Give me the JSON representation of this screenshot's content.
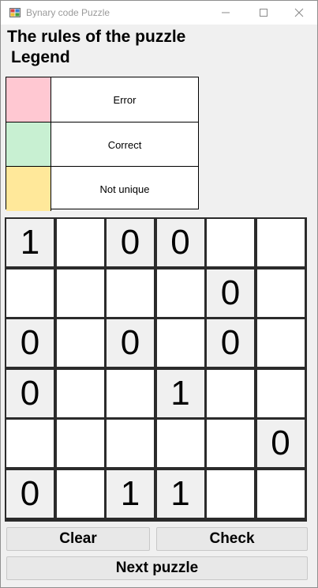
{
  "window": {
    "title": "Bynary code Puzzle",
    "icon": "app-icon",
    "controls": [
      "minimize-icon",
      "maximize-icon",
      "close-icon"
    ]
  },
  "rules_link": "The rules of the puzzle",
  "legend": {
    "title": "Legend",
    "items": [
      {
        "label": "Error",
        "color": "#ffc8d2"
      },
      {
        "label": "Correct",
        "color": "#c8f0d2"
      },
      {
        "label": "Not unique",
        "color": "#ffe89a"
      }
    ]
  },
  "board": {
    "rows": [
      [
        "1",
        "",
        "0",
        "0",
        "",
        ""
      ],
      [
        "",
        "",
        "",
        "",
        "0",
        ""
      ],
      [
        "0",
        "",
        "0",
        "",
        "0",
        ""
      ],
      [
        "0",
        "",
        "",
        "1",
        "",
        ""
      ],
      [
        "",
        "",
        "",
        "",
        "",
        "0"
      ],
      [
        "0",
        "",
        "1",
        "1",
        "",
        ""
      ]
    ]
  },
  "buttons": {
    "clear": "Clear",
    "check": "Check",
    "next": "Next puzzle"
  }
}
